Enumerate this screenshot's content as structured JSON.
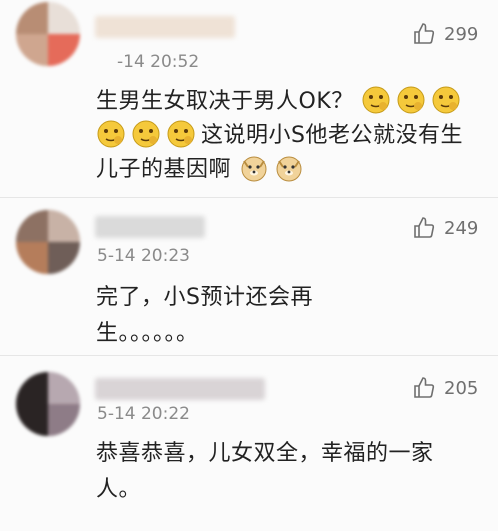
{
  "comments": [
    {
      "time": "-14 20:52",
      "likes": "299",
      "text_lines": [
        "生男生女取决于男人OK？",
        "这说明小S他老公就没有生",
        "儿子的基因啊"
      ],
      "avatar_icon": "blurred-avatar",
      "emoji_icons": [
        "thinking-face-icon",
        "doge-icon"
      ]
    },
    {
      "time": "5-14 20:23",
      "likes": "249",
      "text_lines": [
        "完了，小S预计还会再",
        "生。。。。。。"
      ],
      "avatar_icon": "blurred-avatar"
    },
    {
      "time": "5-14 20:22",
      "likes": "205",
      "text_lines": [
        "恭喜恭喜，儿女双全，幸福的一家",
        "人。"
      ],
      "avatar_icon": "blurred-avatar"
    }
  ],
  "colors": {
    "background": "#fbfbfb",
    "time_text": "#8a8a8a",
    "divider": "#e6e6e6",
    "like_icon": "#6f6f6f"
  }
}
